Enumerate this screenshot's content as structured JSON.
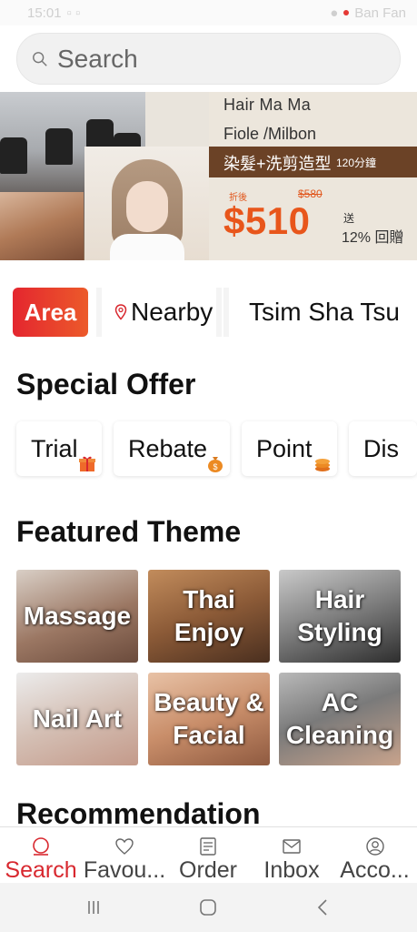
{
  "status_bar": {
    "time": "15:01",
    "right_text": "Ban Fan"
  },
  "search": {
    "placeholder": "Search"
  },
  "banner": {
    "brand": "Hair Ma Ma",
    "products": "Fiole /Milbon",
    "service": "染髮+洗剪造型",
    "duration": "120分鐘",
    "discount_label": "折後",
    "original_price": "$580",
    "price": "$510",
    "gift_label": "送",
    "rebate": "12% 回贈"
  },
  "area": {
    "area_label": "Area",
    "nearby_label": "Nearby",
    "district": "Tsim Sha Tsu"
  },
  "special_offer": {
    "title": "Special Offer",
    "items": [
      {
        "label": "Trial",
        "icon": "gift-icon"
      },
      {
        "label": "Rebate",
        "icon": "money-bag-icon"
      },
      {
        "label": "Point",
        "icon": "coins-icon"
      },
      {
        "label": "Dis",
        "icon": ""
      }
    ]
  },
  "featured_theme": {
    "title": "Featured Theme",
    "tiles": [
      {
        "label": "Massage"
      },
      {
        "label": "Thai Enjoy"
      },
      {
        "label": "Hair Styling"
      },
      {
        "label": "Nail Art"
      },
      {
        "label": "Beauty & Facial"
      },
      {
        "label": "AC Cleaning"
      }
    ]
  },
  "recommendation": {
    "title": "Recommendation"
  },
  "bottom_nav": [
    {
      "label": "Search",
      "icon": "search-icon",
      "active": true
    },
    {
      "label": "Favou...",
      "icon": "heart-icon",
      "active": false
    },
    {
      "label": "Order",
      "icon": "receipt-icon",
      "active": false
    },
    {
      "label": "Inbox",
      "icon": "mail-icon",
      "active": false
    },
    {
      "label": "Acco...",
      "icon": "user-icon",
      "active": false
    }
  ],
  "colors": {
    "brand_red": "#e4262f",
    "price_orange": "#e8561b",
    "banner_strip": "#6b4226"
  }
}
